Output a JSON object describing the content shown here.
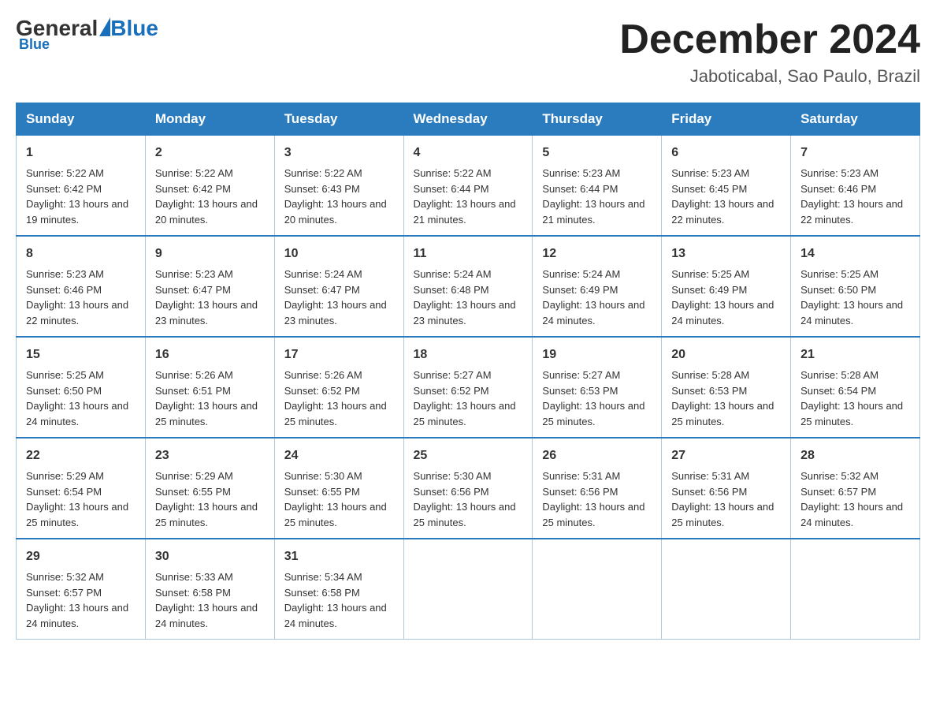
{
  "logo": {
    "general": "General",
    "blue": "Blue"
  },
  "title": {
    "month_year": "December 2024",
    "location": "Jaboticabal, Sao Paulo, Brazil"
  },
  "days_of_week": [
    "Sunday",
    "Monday",
    "Tuesday",
    "Wednesday",
    "Thursday",
    "Friday",
    "Saturday"
  ],
  "weeks": [
    [
      {
        "day": "1",
        "sunrise": "5:22 AM",
        "sunset": "6:42 PM",
        "daylight": "13 hours and 19 minutes."
      },
      {
        "day": "2",
        "sunrise": "5:22 AM",
        "sunset": "6:42 PM",
        "daylight": "13 hours and 20 minutes."
      },
      {
        "day": "3",
        "sunrise": "5:22 AM",
        "sunset": "6:43 PM",
        "daylight": "13 hours and 20 minutes."
      },
      {
        "day": "4",
        "sunrise": "5:22 AM",
        "sunset": "6:44 PM",
        "daylight": "13 hours and 21 minutes."
      },
      {
        "day": "5",
        "sunrise": "5:23 AM",
        "sunset": "6:44 PM",
        "daylight": "13 hours and 21 minutes."
      },
      {
        "day": "6",
        "sunrise": "5:23 AM",
        "sunset": "6:45 PM",
        "daylight": "13 hours and 22 minutes."
      },
      {
        "day": "7",
        "sunrise": "5:23 AM",
        "sunset": "6:46 PM",
        "daylight": "13 hours and 22 minutes."
      }
    ],
    [
      {
        "day": "8",
        "sunrise": "5:23 AM",
        "sunset": "6:46 PM",
        "daylight": "13 hours and 22 minutes."
      },
      {
        "day": "9",
        "sunrise": "5:23 AM",
        "sunset": "6:47 PM",
        "daylight": "13 hours and 23 minutes."
      },
      {
        "day": "10",
        "sunrise": "5:24 AM",
        "sunset": "6:47 PM",
        "daylight": "13 hours and 23 minutes."
      },
      {
        "day": "11",
        "sunrise": "5:24 AM",
        "sunset": "6:48 PM",
        "daylight": "13 hours and 23 minutes."
      },
      {
        "day": "12",
        "sunrise": "5:24 AM",
        "sunset": "6:49 PM",
        "daylight": "13 hours and 24 minutes."
      },
      {
        "day": "13",
        "sunrise": "5:25 AM",
        "sunset": "6:49 PM",
        "daylight": "13 hours and 24 minutes."
      },
      {
        "day": "14",
        "sunrise": "5:25 AM",
        "sunset": "6:50 PM",
        "daylight": "13 hours and 24 minutes."
      }
    ],
    [
      {
        "day": "15",
        "sunrise": "5:25 AM",
        "sunset": "6:50 PM",
        "daylight": "13 hours and 24 minutes."
      },
      {
        "day": "16",
        "sunrise": "5:26 AM",
        "sunset": "6:51 PM",
        "daylight": "13 hours and 25 minutes."
      },
      {
        "day": "17",
        "sunrise": "5:26 AM",
        "sunset": "6:52 PM",
        "daylight": "13 hours and 25 minutes."
      },
      {
        "day": "18",
        "sunrise": "5:27 AM",
        "sunset": "6:52 PM",
        "daylight": "13 hours and 25 minutes."
      },
      {
        "day": "19",
        "sunrise": "5:27 AM",
        "sunset": "6:53 PM",
        "daylight": "13 hours and 25 minutes."
      },
      {
        "day": "20",
        "sunrise": "5:28 AM",
        "sunset": "6:53 PM",
        "daylight": "13 hours and 25 minutes."
      },
      {
        "day": "21",
        "sunrise": "5:28 AM",
        "sunset": "6:54 PM",
        "daylight": "13 hours and 25 minutes."
      }
    ],
    [
      {
        "day": "22",
        "sunrise": "5:29 AM",
        "sunset": "6:54 PM",
        "daylight": "13 hours and 25 minutes."
      },
      {
        "day": "23",
        "sunrise": "5:29 AM",
        "sunset": "6:55 PM",
        "daylight": "13 hours and 25 minutes."
      },
      {
        "day": "24",
        "sunrise": "5:30 AM",
        "sunset": "6:55 PM",
        "daylight": "13 hours and 25 minutes."
      },
      {
        "day": "25",
        "sunrise": "5:30 AM",
        "sunset": "6:56 PM",
        "daylight": "13 hours and 25 minutes."
      },
      {
        "day": "26",
        "sunrise": "5:31 AM",
        "sunset": "6:56 PM",
        "daylight": "13 hours and 25 minutes."
      },
      {
        "day": "27",
        "sunrise": "5:31 AM",
        "sunset": "6:56 PM",
        "daylight": "13 hours and 25 minutes."
      },
      {
        "day": "28",
        "sunrise": "5:32 AM",
        "sunset": "6:57 PM",
        "daylight": "13 hours and 24 minutes."
      }
    ],
    [
      {
        "day": "29",
        "sunrise": "5:32 AM",
        "sunset": "6:57 PM",
        "daylight": "13 hours and 24 minutes."
      },
      {
        "day": "30",
        "sunrise": "5:33 AM",
        "sunset": "6:58 PM",
        "daylight": "13 hours and 24 minutes."
      },
      {
        "day": "31",
        "sunrise": "5:34 AM",
        "sunset": "6:58 PM",
        "daylight": "13 hours and 24 minutes."
      },
      null,
      null,
      null,
      null
    ]
  ]
}
